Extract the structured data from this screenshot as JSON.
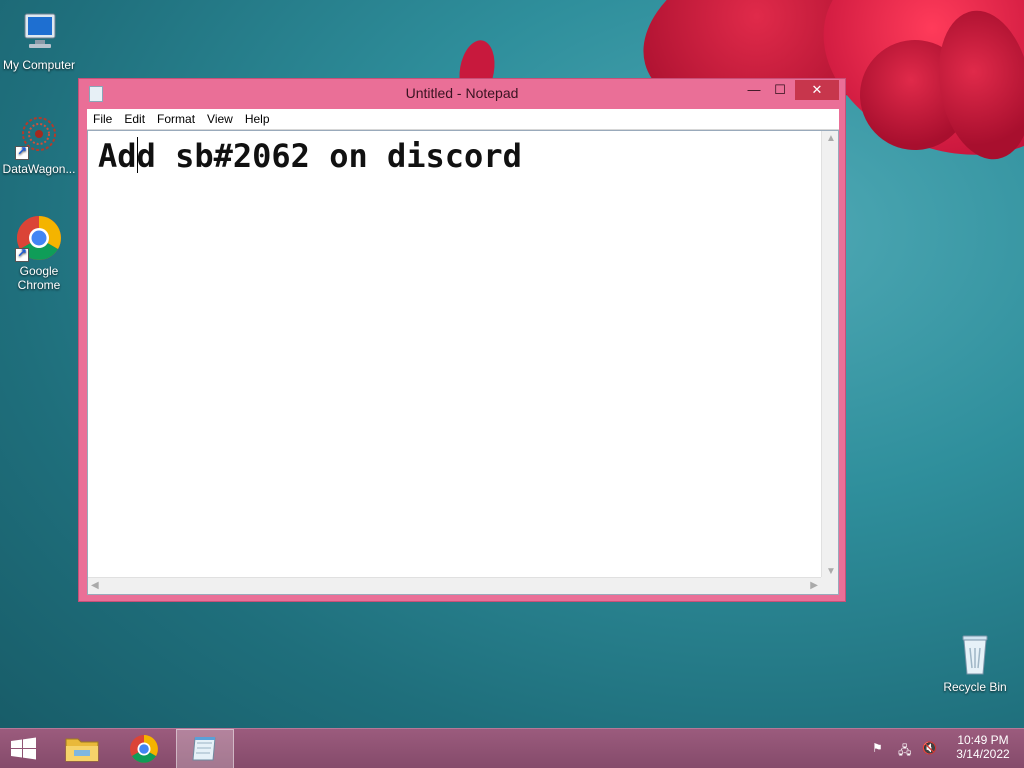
{
  "desktop": {
    "icons": [
      {
        "label": "My Computer"
      },
      {
        "label": "DataWagon..."
      },
      {
        "label": "Google Chrome"
      },
      {
        "label": "Recycle Bin"
      }
    ]
  },
  "window": {
    "title": "Untitled - Notepad",
    "controls": {
      "minimize": "—",
      "maximize": "☐",
      "close": "✕"
    },
    "menu": [
      "File",
      "Edit",
      "Format",
      "View",
      "Help"
    ],
    "content": "Add sb#2062 on discord"
  },
  "taskbar": {
    "time": "10:49 PM",
    "date": "3/14/2022"
  },
  "colors": {
    "window_frame": "#ea6f97",
    "close_button": "#c7364c",
    "taskbar": "#8f5274"
  }
}
